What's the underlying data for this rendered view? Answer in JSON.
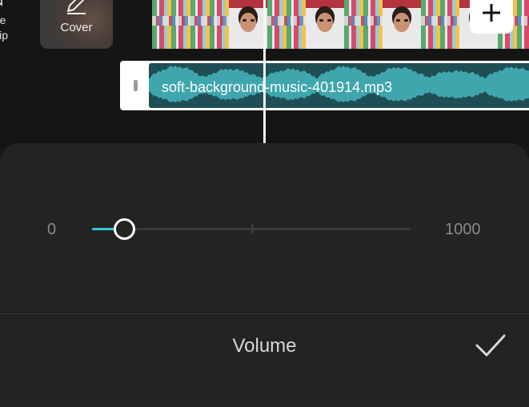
{
  "toolbar": {
    "mute_label_line1": "ute",
    "mute_label_line2": "lip",
    "cover_label": "Cover"
  },
  "timeline": {
    "audio_clip_name": "soft-background-music-401914.mp3"
  },
  "volume_panel": {
    "title": "Volume",
    "range_min": "0",
    "range_max": "1000",
    "current_value": 100,
    "max_value": 1000,
    "accent_color": "#33c5d6"
  },
  "icons": {
    "mute": "speaker-mute-icon",
    "cover": "edit-pencil-icon",
    "add_clip": "plus-icon",
    "confirm": "checkmark-icon"
  }
}
